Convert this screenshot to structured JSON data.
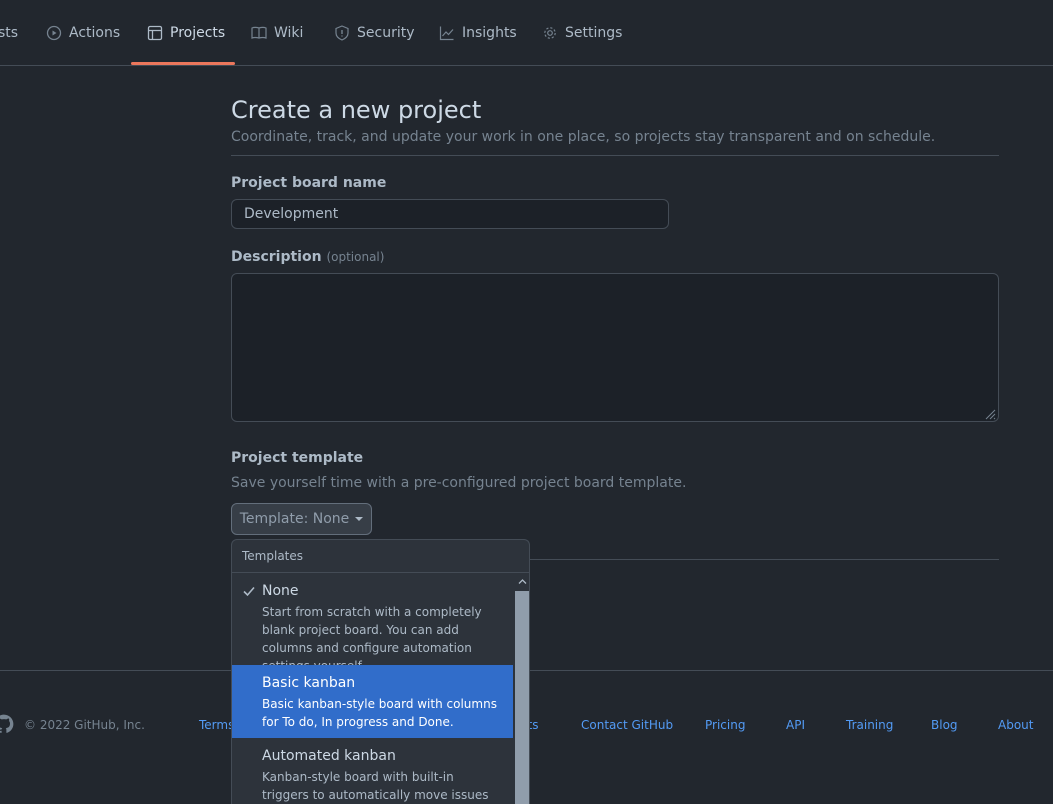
{
  "tabs": [
    {
      "label": "sts",
      "icon": "truncated"
    },
    {
      "label": "Actions",
      "icon": "play-circle-icon"
    },
    {
      "label": "Projects",
      "icon": "table-icon",
      "active": true
    },
    {
      "label": "Wiki",
      "icon": "book-icon"
    },
    {
      "label": "Security",
      "icon": "shield-icon"
    },
    {
      "label": "Insights",
      "icon": "graph-icon"
    },
    {
      "label": "Settings",
      "icon": "gear-icon"
    }
  ],
  "page": {
    "title": "Create a new project",
    "subtitle": "Coordinate, track, and update your work in one place, so projects stay transparent and on schedule."
  },
  "form": {
    "name_label": "Project board name",
    "name_value": "Development",
    "description_label": "Description",
    "description_optional": "(optional)",
    "description_value": "",
    "template_label": "Project template",
    "template_help": "Save yourself time with a pre-configured project board template.",
    "template_button": "Template: None"
  },
  "dropdown": {
    "header": "Templates",
    "items": [
      {
        "name": "None",
        "desc": "Start from scratch with a completely blank project board. You can add columns and configure automation settings yourself.",
        "checked": true
      },
      {
        "name": "Basic kanban",
        "desc": "Basic kanban-style board with columns for To do, In progress and Done.",
        "highlighted": true
      },
      {
        "name": "Automated kanban",
        "desc": "Kanban-style board with built-in triggers to automatically move issues and pull requests"
      }
    ]
  },
  "footer": {
    "copyright": "© 2022 GitHub, Inc.",
    "links": [
      "Terms",
      "cts",
      "Contact GitHub",
      "Pricing",
      "API",
      "Training",
      "Blog",
      "About"
    ]
  },
  "colors": {
    "background": "#22272e",
    "accent_underline": "#ec775c",
    "link": "#539bf5",
    "selected_item": "#316dca"
  }
}
